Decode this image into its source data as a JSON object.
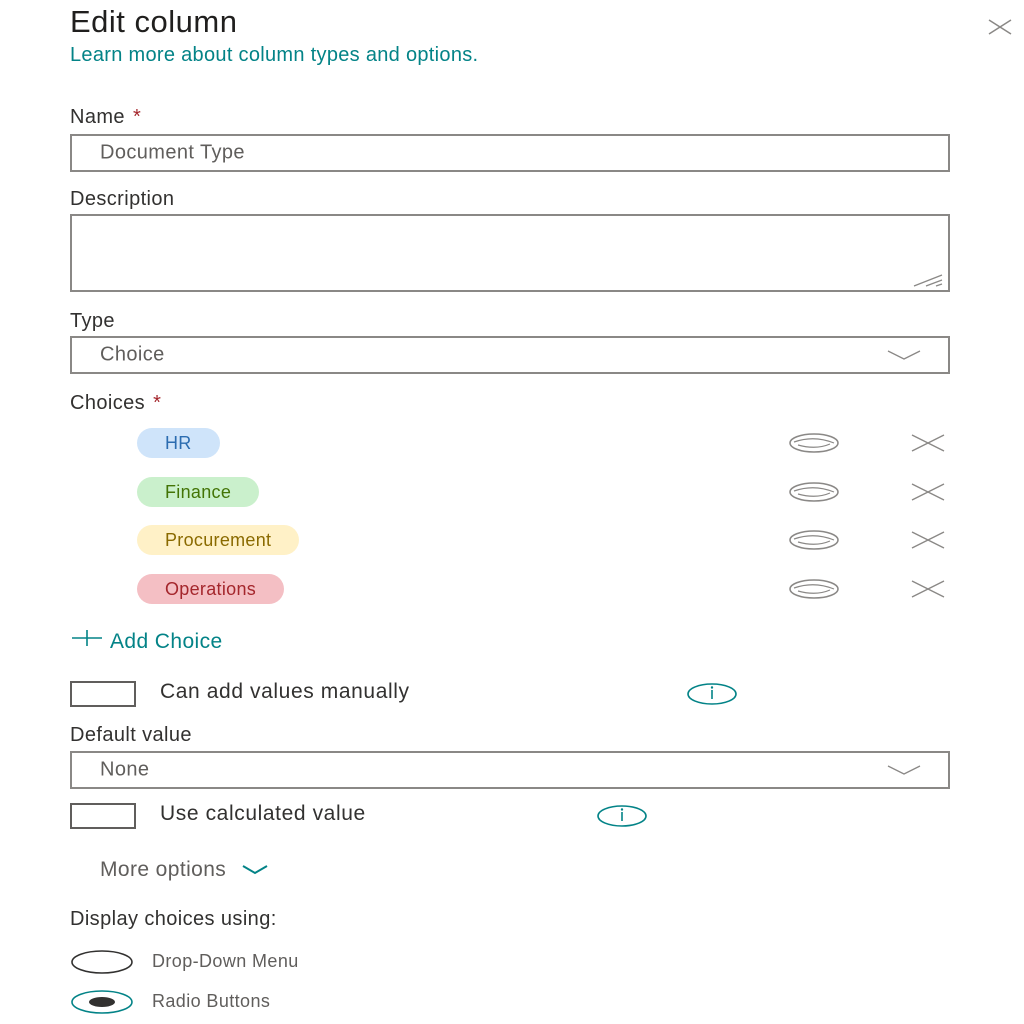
{
  "panel": {
    "title": "Edit column",
    "learn_more": "Learn more about column types and options.",
    "name": {
      "label": "Name",
      "required": "*",
      "value": "Document Type"
    },
    "description": {
      "label": "Description",
      "value": ""
    },
    "type": {
      "label": "Type",
      "value": "Choice"
    },
    "choices": {
      "label": "Choices",
      "required": "*",
      "items": [
        {
          "label": "HR",
          "bg": "#cfe4fa",
          "fg": "#2b6cb0"
        },
        {
          "label": "Finance",
          "bg": "#caf0cc",
          "fg": "#437406"
        },
        {
          "label": "Procurement",
          "bg": "#fff1c7",
          "fg": "#8a6a00"
        },
        {
          "label": "Operations",
          "bg": "#f4bfc4",
          "fg": "#a4262c"
        }
      ],
      "add_label": "Add Choice"
    },
    "manual_values": {
      "label": "Can add values manually",
      "checked": false
    },
    "default_value": {
      "label": "Default value",
      "value": "None"
    },
    "calculated_value": {
      "label": "Use calculated value",
      "checked": false
    },
    "more_options": "More options",
    "display": {
      "label": "Display choices using:",
      "options": [
        {
          "label": "Drop-Down Menu",
          "selected": false
        },
        {
          "label": "Radio Buttons",
          "selected": true
        }
      ]
    }
  },
  "colors": {
    "accent": "#038387",
    "required": "#a4262c",
    "border": "#8a8886"
  }
}
